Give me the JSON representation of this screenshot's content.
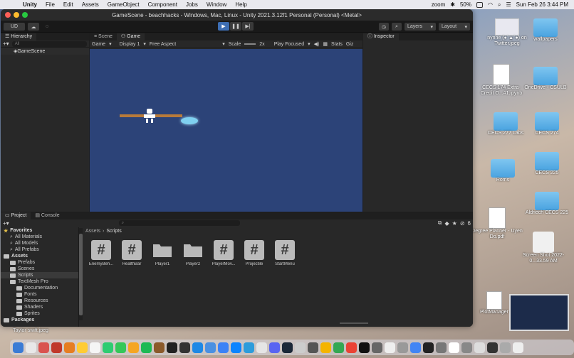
{
  "menubar": {
    "app": "Unity",
    "items": [
      "File",
      "Edit",
      "Assets",
      "GameObject",
      "Component",
      "Jobs",
      "Window",
      "Help"
    ],
    "battery": "50%",
    "zoom_label": "zoom",
    "datetime": "Sun Feb 26  3:44 PM"
  },
  "window": {
    "title": "GameScene - beachhacks - Windows, Mac, Linux - Unity 2021.3.12f1 Personal (Personal) <Metal>"
  },
  "toolbar": {
    "account": "UD",
    "layers": "Layers",
    "layout": "Layout"
  },
  "hierarchy": {
    "tab": "Hierarchy",
    "search_placeholder": "All",
    "root": "GameScene"
  },
  "game_view": {
    "scene_tab": "Scene",
    "game_tab": "Game",
    "mode": "Game",
    "display": "Display 1",
    "aspect": "Free Aspect",
    "scale_label": "Scale",
    "scale_value": "2x",
    "play_focus": "Play Focused",
    "stats": "Stats",
    "gizmos": "Giz"
  },
  "inspector": {
    "tab": "Inspector"
  },
  "project": {
    "tab": "Project",
    "console_tab": "Console",
    "hidden_count": "6",
    "breadcrumb": [
      "Assets",
      "Scripts"
    ],
    "tree": [
      {
        "label": "Favorites",
        "level": 0,
        "type": "star",
        "head": true
      },
      {
        "label": "All Materials",
        "level": 1,
        "type": "search"
      },
      {
        "label": "All Models",
        "level": 1,
        "type": "search"
      },
      {
        "label": "All Prefabs",
        "level": 1,
        "type": "search"
      },
      {
        "label": "Assets",
        "level": 0,
        "type": "folder",
        "head": true
      },
      {
        "label": "Prefabs",
        "level": 1,
        "type": "folder"
      },
      {
        "label": "Scenes",
        "level": 1,
        "type": "folder"
      },
      {
        "label": "Scripts",
        "level": 1,
        "type": "folder",
        "selected": true
      },
      {
        "label": "TextMesh Pro",
        "level": 1,
        "type": "folder"
      },
      {
        "label": "Documentation",
        "level": 2,
        "type": "folder"
      },
      {
        "label": "Fonts",
        "level": 2,
        "type": "folder"
      },
      {
        "label": "Resources",
        "level": 2,
        "type": "folder"
      },
      {
        "label": "Shaders",
        "level": 2,
        "type": "folder"
      },
      {
        "label": "Sprites",
        "level": 2,
        "type": "folder"
      },
      {
        "label": "Packages",
        "level": 0,
        "type": "folder",
        "head": true
      }
    ],
    "assets": [
      {
        "name": "EnemyBeh...",
        "type": "script"
      },
      {
        "name": "HealthBar",
        "type": "script"
      },
      {
        "name": "Player1",
        "type": "folder"
      },
      {
        "name": "Player2",
        "type": "folder"
      },
      {
        "name": "PlayerMov...",
        "type": "script"
      },
      {
        "name": "Projectile",
        "type": "script"
      },
      {
        "name": "StartMenu",
        "type": "script"
      }
    ]
  },
  "desktop": {
    "items": [
      {
        "label": "nynne (●´▲`●) on Twitter.jpeg",
        "kind": "image"
      },
      {
        "label": "wallpapers",
        "kind": "folder"
      },
      {
        "label": "CECS 174 Extra-Credit O...#1.ipynb",
        "kind": "doc"
      },
      {
        "label": "OneDrive - CSULB",
        "kind": "folder"
      },
      {
        "label": "CECS 277 Labs",
        "kind": "folder"
      },
      {
        "label": "CECS 274",
        "kind": "folder"
      },
      {
        "label": "CECS 225",
        "kind": "folder"
      },
      {
        "label": "Roms",
        "kind": "folder"
      },
      {
        "label": "Degree Planner - Uyen Do.pdf",
        "kind": "doc"
      },
      {
        "label": "Aldriech CECS 225",
        "kind": "folder"
      },
      {
        "label": "Screen Shot 2022-0...33.59 AM",
        "kind": "image"
      },
      {
        "label": "PlotManager",
        "kind": "doc"
      },
      {
        "label": "Taylor swift.jpeg",
        "kind": "image"
      }
    ]
  },
  "colors": {
    "game_bg": "#2c4378",
    "play_active": "#3d6eb4"
  }
}
